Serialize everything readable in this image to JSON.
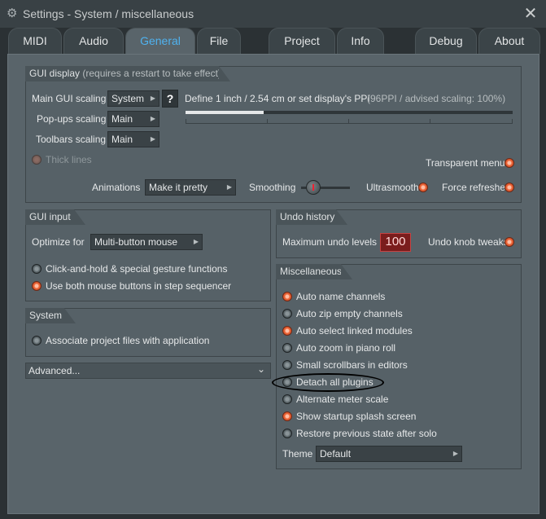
{
  "window": {
    "title": "Settings - System / miscellaneous",
    "close_label": "✕"
  },
  "tabs": [
    {
      "label": "MIDI"
    },
    {
      "label": "Audio"
    },
    {
      "label": "General",
      "active": true
    },
    {
      "label": "File"
    },
    {
      "label": "Project"
    },
    {
      "label": "Info"
    },
    {
      "label": "Debug"
    },
    {
      "label": "About"
    }
  ],
  "gui_display": {
    "header": "GUI display",
    "header_note": "(requires a restart to take effect)",
    "main_scaling_label": "Main GUI scaling",
    "main_scaling_value": "System",
    "help_button": "?",
    "ppi_label": "Define 1 inch / 2.54 cm or set display's PPI",
    "ppi_note": "(96PPI / advised scaling: 100%)",
    "popups_label": "Pop-ups scaling",
    "popups_value": "Main",
    "toolbars_label": "Toolbars scaling",
    "toolbars_value": "Main",
    "thick_lines": "Thick lines",
    "transparent_menus": "Transparent menus",
    "animations_label": "Animations",
    "animations_value": "Make it pretty",
    "smoothing_label": "Smoothing",
    "ultrasmooth": "Ultrasmooth",
    "force_refreshes": "Force refreshes"
  },
  "gui_input": {
    "header": "GUI input",
    "optimize_label": "Optimize for",
    "optimize_value": "Multi-button mouse",
    "opt1": "Click-and-hold & special gesture functions",
    "opt2": "Use both mouse buttons in step sequencer"
  },
  "system": {
    "header": "System",
    "associate": "Associate project files with application"
  },
  "advanced": {
    "label": "Advanced..."
  },
  "undo": {
    "header": "Undo history",
    "max_label": "Maximum undo levels",
    "max_value": "100",
    "knob_tweaks": "Undo knob tweaks"
  },
  "misc": {
    "header": "Miscellaneous",
    "items": [
      {
        "label": "Auto name channels",
        "on": true
      },
      {
        "label": "Auto zip empty channels",
        "on": false
      },
      {
        "label": "Auto select linked modules",
        "on": true
      },
      {
        "label": "Auto zoom in piano roll",
        "on": false
      },
      {
        "label": "Small scrollbars in editors",
        "on": false
      },
      {
        "label": "Detach all plugins",
        "on": false
      },
      {
        "label": "Alternate meter scale",
        "on": false
      },
      {
        "label": "Show startup splash screen",
        "on": true
      },
      {
        "label": "Restore previous state after solo",
        "on": false
      }
    ],
    "theme_label": "Theme",
    "theme_value": "Default"
  },
  "colors": {
    "accent_tab": "#4fb2ef",
    "radio_on": "#f06a3c",
    "undo_box": "#7a1d1d"
  }
}
